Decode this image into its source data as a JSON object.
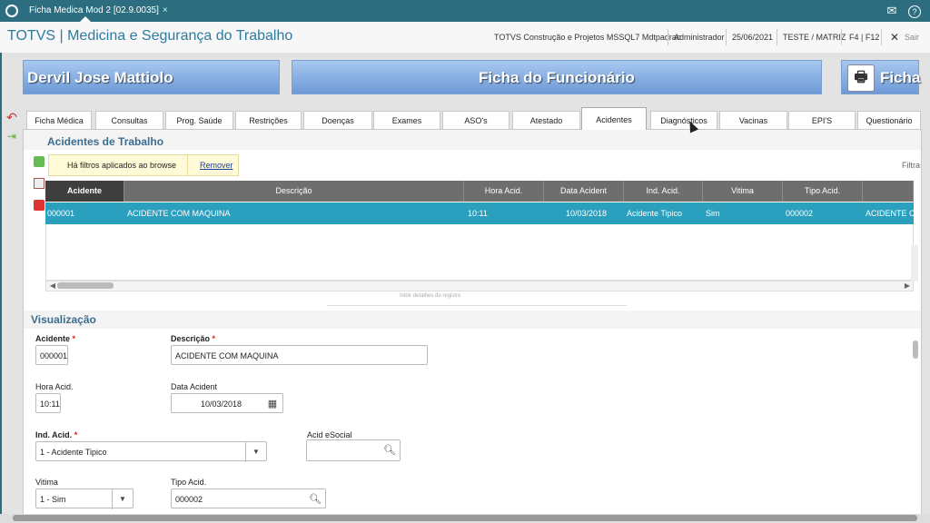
{
  "topbar": {
    "tab_label": "Ficha Medica Mod 2 [02.9.0035]",
    "tab_close": "×",
    "mail_icon": "✉",
    "help_icon": "?"
  },
  "header": {
    "title": "TOTVS | Medicina e Segurança do Trabalho",
    "company": "TOTVS Construção e Projetos MSSQL7 Mdtpadrao",
    "user": "Administrador",
    "date": "25/06/2021",
    "branch": "TESTE / MATRIZ",
    "shortcut": "F4 | F12",
    "exit_label": "Sair",
    "exit_icon": "✕"
  },
  "banners": {
    "employee_name": "Dervil Jose Mattiolo",
    "screen_title": "Ficha do Funcionário",
    "print_label": "Ficha",
    "print_icon": "🖶"
  },
  "tabs": [
    {
      "label": "Ficha Médica"
    },
    {
      "label": "Consultas"
    },
    {
      "label": "Prog. Saúde"
    },
    {
      "label": "Restrições"
    },
    {
      "label": "Doenças"
    },
    {
      "label": "Exames"
    },
    {
      "label": "ASO's"
    },
    {
      "label": "Atestado"
    },
    {
      "label": "Acidentes"
    },
    {
      "label": "Diagnósticos"
    },
    {
      "label": "Vacinas"
    },
    {
      "label": "EPI'S"
    },
    {
      "label": "Questionário"
    }
  ],
  "browse": {
    "section_title": "Acidentes de Trabalho",
    "filter_text": "Há filtros aplicados ao browse",
    "remove_link": "Remover",
    "filter_label": "Filtra",
    "columns": [
      "Acidente",
      "Descrição",
      "Hora Acid.",
      "Data Acident",
      "Ind. Acid.",
      "Vitima",
      "Tipo Acid.",
      ""
    ],
    "rows": [
      [
        "000001",
        "ACIDENTE COM MAQUINA",
        "10:11",
        "10/03/2018",
        "Acidente Tipico",
        "Sim",
        "000002",
        "ACIDENTE CO"
      ]
    ],
    "details_hint": "Inibir detalhes do registro"
  },
  "form": {
    "section_title": "Visualização",
    "required_mark": "*",
    "acidente": {
      "label": "Acidente",
      "value": "000001"
    },
    "descricao": {
      "label": "Descrição",
      "value": "ACIDENTE COM MAQUINA"
    },
    "hora": {
      "label": "Hora Acid.",
      "value": "10:11"
    },
    "data": {
      "label": "Data Acident",
      "value": "10/03/2018"
    },
    "ind": {
      "label": "Ind. Acid.",
      "value": "1 - Acidente Tipico"
    },
    "esocial": {
      "label": "Acid eSocial",
      "value": ""
    },
    "vitima": {
      "label": "Vitima",
      "value": "1 - Sim"
    },
    "tipo": {
      "label": "Tipo Acid.",
      "value": "000002"
    }
  },
  "colors": {
    "accent": "#2c6e7f",
    "row_selected": "#2aa0be",
    "banner": "#6c99d6"
  }
}
